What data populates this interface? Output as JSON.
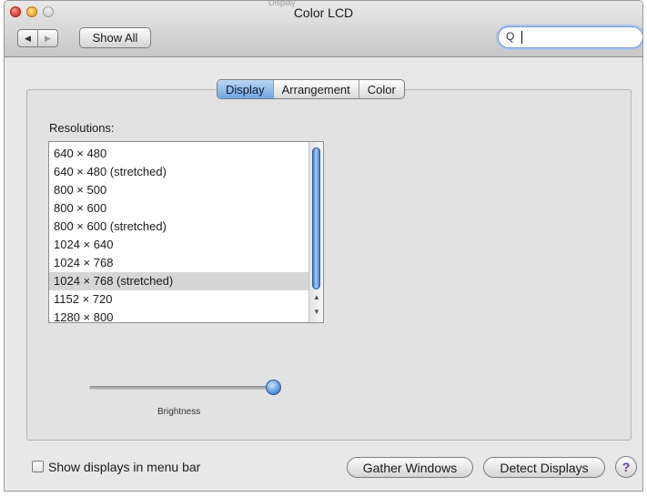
{
  "window": {
    "title": "Color LCD",
    "ghost_title": "Display"
  },
  "toolbar": {
    "back_glyph": "◀",
    "forward_glyph": "▶",
    "show_all_label": "Show All",
    "search": {
      "icon": "magnifier-icon",
      "value": ""
    }
  },
  "tabs": [
    {
      "label": "Display",
      "selected": true
    },
    {
      "label": "Arrangement",
      "selected": false
    },
    {
      "label": "Color",
      "selected": false
    }
  ],
  "resolutions": {
    "label": "Resolutions:",
    "items": [
      "640 × 480",
      "640 × 480 (stretched)",
      "800 × 500",
      "800 × 600",
      "800 × 600 (stretched)",
      "1024 × 640",
      "1024 × 768",
      "1024 × 768 (stretched)",
      "1152 × 720",
      "1280 × 800"
    ],
    "selected_index": 7,
    "scroll_up_glyph": "▲",
    "scroll_down_glyph": "▼"
  },
  "brightness": {
    "label": "Brightness",
    "value": 0.97
  },
  "footer": {
    "show_in_menu_bar_label": "Show displays in menu bar",
    "show_in_menu_bar_checked": false,
    "gather_windows_label": "Gather Windows",
    "detect_displays_label": "Detect Displays",
    "help_glyph": "?"
  },
  "colors": {
    "accent": "#6fa6e4",
    "selection_row": "#d6d6d6",
    "close": "#e0443a",
    "minimize": "#f3b13a"
  }
}
